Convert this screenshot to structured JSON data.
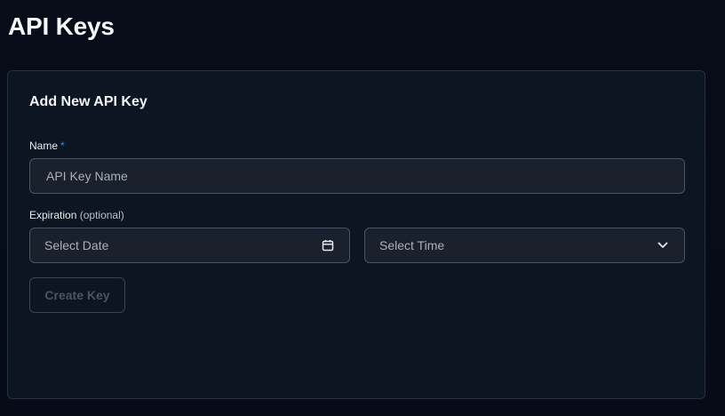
{
  "page": {
    "title": "API Keys"
  },
  "form": {
    "title": "Add New API Key",
    "name_label": "Name",
    "required_mark": "*",
    "name_placeholder": "API Key Name",
    "expiration_label": "Expiration",
    "expiration_optional": "(optional)",
    "date_placeholder": "Select Date",
    "time_placeholder": "Select Time",
    "create_button": "Create Key",
    "create_button_disabled": true
  },
  "icons": {
    "date": "calendar-icon",
    "time": "chevron-down-icon"
  },
  "colors": {
    "background": "#070c19",
    "card": "#0d1422",
    "card_border": "#273042",
    "input_bg": "#1a202c",
    "input_border": "#4a5466",
    "required": "#3b82f6",
    "disabled_text": "#4b5466"
  }
}
